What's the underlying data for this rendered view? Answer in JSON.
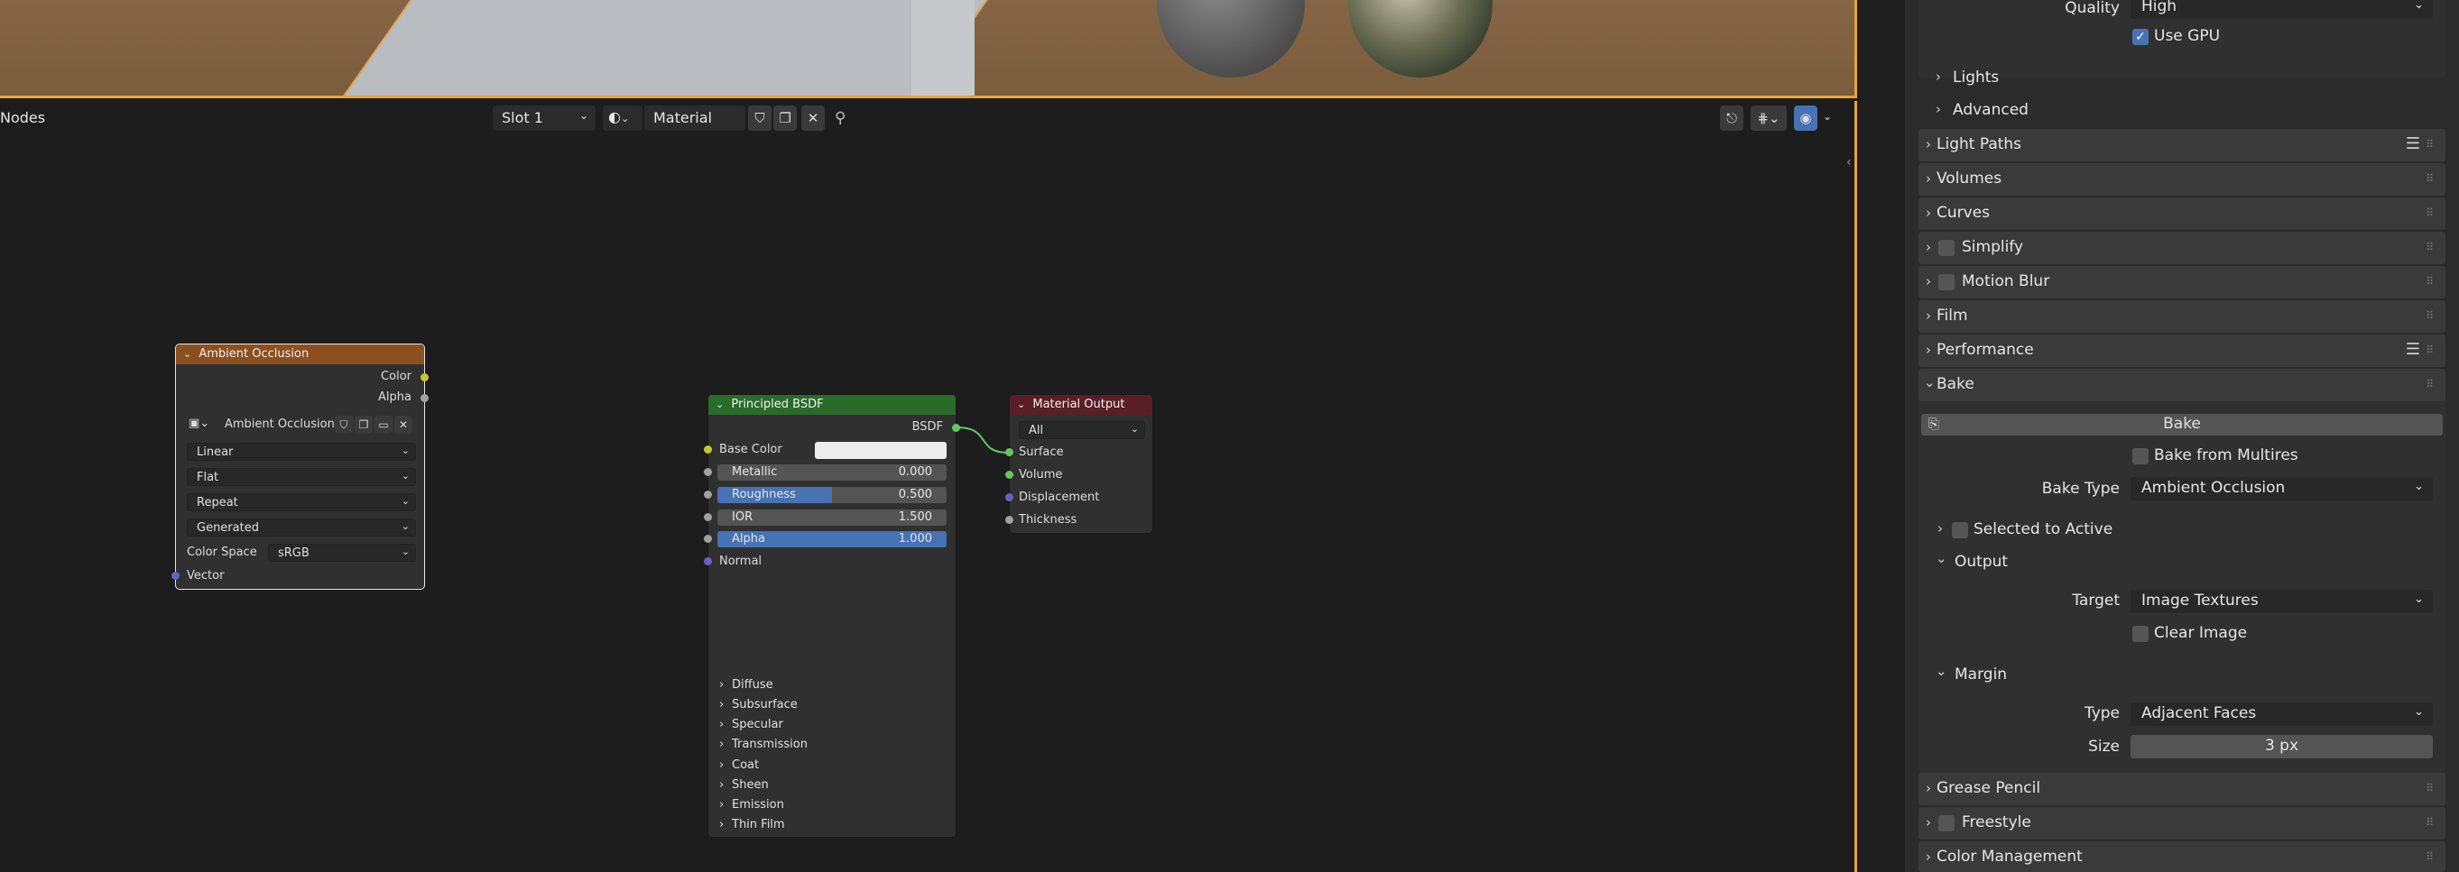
{
  "viewport": {},
  "node_editor": {
    "title": "Nodes",
    "slot": "Slot 1",
    "material_name": "Material"
  },
  "nodes": {
    "ao": {
      "title": "Ambient Occlusion",
      "out_color": "Color",
      "out_alpha": "Alpha",
      "image_name": "Ambient Occlusion",
      "interp": "Linear",
      "proj": "Flat",
      "ext": "Repeat",
      "source": "Generated",
      "cs_label": "Color Space",
      "cs_value": "sRGB",
      "in_vector": "Vector"
    },
    "bsdf": {
      "title": "Principled BSDF",
      "out": "BSDF",
      "base_color": "Base Color",
      "metallic": "Metallic",
      "metallic_val": "0.000",
      "roughness": "Roughness",
      "roughness_val": "0.500",
      "roughness_fill": 0.5,
      "ior": "IOR",
      "ior_val": "1.500",
      "alpha": "Alpha",
      "alpha_val": "1.000",
      "normal": "Normal",
      "panels": [
        "Diffuse",
        "Subsurface",
        "Specular",
        "Transmission",
        "Coat",
        "Sheen",
        "Emission",
        "Thin Film"
      ]
    },
    "output": {
      "title": "Material Output",
      "target": "All",
      "surface": "Surface",
      "volume": "Volume",
      "displacement": "Displacement",
      "thickness": "Thickness"
    }
  },
  "props": {
    "quality_label": "Quality",
    "quality_value": "High",
    "use_gpu": "Use GPU",
    "lights": "Lights",
    "advanced": "Advanced",
    "light_paths": "Light Paths",
    "volumes": "Volumes",
    "curves": "Curves",
    "simplify": "Simplify",
    "motion_blur": "Motion Blur",
    "film": "Film",
    "performance": "Performance",
    "bake": "Bake",
    "bake_button": "Bake",
    "bake_from_multires": "Bake from Multires",
    "bake_type_label": "Bake Type",
    "bake_type_value": "Ambient Occlusion",
    "selected_to_active": "Selected to Active",
    "output": "Output",
    "target_label": "Target",
    "target_value": "Image Textures",
    "clear_image": "Clear Image",
    "margin": "Margin",
    "type_label": "Type",
    "type_value": "Adjacent Faces",
    "size_label": "Size",
    "size_value": "3 px",
    "grease_pencil": "Grease Pencil",
    "freestyle": "Freestyle",
    "color_management": "Color Management"
  },
  "colors": {
    "accent": "#4772b3",
    "active_border": "#e8a33b",
    "ao_header": "#8c4f1f",
    "bsdf_header": "#2a6b2a",
    "output_header": "#5a1f26"
  }
}
